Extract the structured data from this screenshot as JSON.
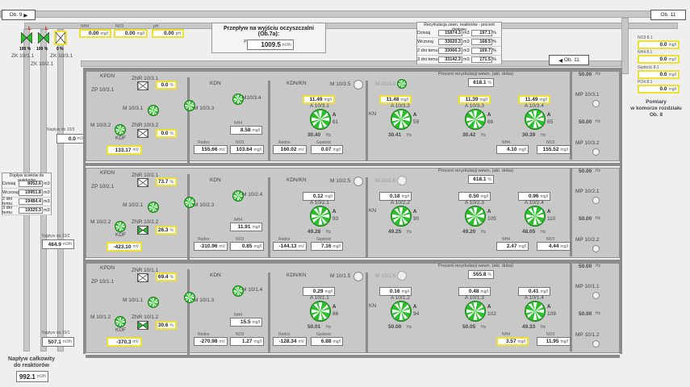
{
  "header": {
    "ob9": "Ob. 9",
    "ob11_top": "Ob. 11",
    "ob11_mid": "Ob. 11"
  },
  "flow_title": "Przepływ na wyjściu oczyszczalni (Ob.7a):",
  "flow_small": "Przepływ 7a.1",
  "flow_value": "1009.5",
  "flow_unit": "m3/h",
  "top_params": [
    {
      "label": "NH4",
      "value": "0.00",
      "unit": "mg/l"
    },
    {
      "label": "NO3",
      "value": "0.00",
      "unit": "mg/l"
    },
    {
      "label": "pH",
      "value": "0.00",
      "unit": "pH"
    }
  ],
  "recirc_ext": {
    "title": "Recyrkulacja zewn. reaktorów - procent dopływu",
    "rows": [
      {
        "d": "Dzisiaj",
        "v": "15874.3",
        "u": "m3",
        "p": "197.1",
        "pu": "%"
      },
      {
        "d": "Wczoraj",
        "v": "33620.3",
        "u": "m3",
        "p": "168.5",
        "pu": "%"
      },
      {
        "d": "2 dni temu",
        "v": "33066.3",
        "u": "m3",
        "p": "169.7",
        "pu": "%"
      },
      {
        "d": "3 dni temu",
        "v": "33142.3",
        "u": "m3",
        "p": "171.5",
        "pu": "%"
      }
    ]
  },
  "left_valves": {
    "zk1": "ZK 10/1.1",
    "zk2": "ZK 10/2.1",
    "zk3": "ZK 10/3.1",
    "p1": "100",
    "p2": "100",
    "p3": "0",
    "pu": "%"
  },
  "doplyw_r": {
    "title": "Dopływ ścieków do reaktorów",
    "rows": [
      {
        "d": "Dzisiaj",
        "v": "8052.6",
        "u": "m3"
      },
      {
        "d": "Wczoraj",
        "v": "19951.8",
        "u": "m3"
      },
      {
        "d": "2 dni temu",
        "v": "19484.4",
        "u": "m3"
      },
      {
        "d": "3 dni temu",
        "v": "19325.3",
        "u": "m3"
      }
    ]
  },
  "naplywy": [
    {
      "label": "Napływ do 10/3",
      "value": "0.0",
      "unit": "m3/h"
    },
    {
      "label": "Napływ do 10/2",
      "value": "484.9",
      "unit": "m3/h"
    },
    {
      "label": "Napływ do 10/1",
      "value": "507.1",
      "unit": "m3/h"
    }
  ],
  "total": {
    "label1": "Napływ całkowity",
    "label2": "do reaktorów",
    "value": "992.1",
    "unit": "m3/h"
  },
  "pomiary": {
    "rows": [
      {
        "label": "NO3 8.1",
        "value": "0.0",
        "unit": "mg/l"
      },
      {
        "label": "NH4 8.1",
        "value": "0.0",
        "unit": "mg/l"
      },
      {
        "label": "Gęstość 8.1",
        "value": "0.0",
        "unit": "mg/l"
      },
      {
        "label": "PO4 8.1",
        "value": "0.0",
        "unit": "mg/l"
      }
    ],
    "title1": "Pomiary",
    "title2": "w komorze rozdziału",
    "title3": "Ob. 8"
  },
  "reactors": [
    {
      "kpdn": "KPDN",
      "zp": "ZP 10/3.1",
      "znr1": "ZNR 10/3.1",
      "znr1v": "0.0",
      "znr2": "ZNR 10/3.2",
      "znr2v": "0.0",
      "m1": "M 10/3.1",
      "m2": "M 10/3.2",
      "m3": "M10/3.4",
      "m35": "M 10/3.5",
      "m36": "M 10/3.6",
      "kdf": "KDF",
      "redox1": "133.17",
      "redox1u": "mV",
      "kdn": "KDN",
      "kdnkn": "KDN/KN",
      "kn": "KN",
      "nh4": "8.58",
      "redox2": "155.66",
      "no3": "103.64",
      "redox3": "160.02",
      "gest": "0.07",
      "o1": "11.49",
      "o2": "11.48",
      "o3": "11.39",
      "o4": "11.49",
      "recirc": "618.1",
      "recirc_title": "Procent recyrkulacji wewn. (akt. doba)",
      "mp1": "MP 10/3.1",
      "mp2": "MP 10/3.2",
      "mp1v": "50.00",
      "mp2v": "50.00",
      "nh4b": "4.10",
      "no3b": "155.52",
      "aer": [
        {
          "n": "A 10/3.1",
          "hz": "30.40",
          "a": "61"
        },
        {
          "n": "A 10/3.2",
          "hz": "30.41",
          "a": "59"
        },
        {
          "n": "A 10/3.3",
          "hz": "30.42",
          "a": "66"
        },
        {
          "n": "A 10/3.4",
          "hz": "30.39",
          "a": "65"
        }
      ]
    },
    {
      "kpdn": "KPDN",
      "zp": "ZP 10/2.1",
      "znr1": "ZNR 10/2.1",
      "znr1v": "73.7",
      "znr2": "ZNR 10/2.2",
      "znr2v": "26.3",
      "m1": "M 10/2.1",
      "m2": "M 10/2.2",
      "m3": "M 10/2.4",
      "m35": "M 10/2.5",
      "m36": "M 10/2.6",
      "kdf": "KDF",
      "redox1": "-423.10",
      "redox1u": "mV",
      "kdn": "KDN",
      "kdnkn": "KDN/KN",
      "kn": "KN",
      "nh4": "11.91",
      "redox2": "-310.96",
      "no3": "0.85",
      "redox3": "-144.13",
      "gest": "7.16",
      "o1": "0.12",
      "o2": "0.18",
      "o3": "0.50",
      "o4": "0.96",
      "recirc": "618.1",
      "recirc_title": "Procent recyrkulacji wewn. (akt. doba)",
      "mp1": "MP 10/2.1",
      "mp2": "MP 10/2.2",
      "mp1v": "50.00",
      "mp2v": "50.00",
      "nh4b": "2.47",
      "no3b": "4.44",
      "p2": "97",
      "vp": "70",
      "aer": [
        {
          "n": "A 10/2.1",
          "hz": "49.28",
          "a": "93"
        },
        {
          "n": "A 10/2.2",
          "hz": "49.25",
          "a": "90"
        },
        {
          "n": "A 10/2.3",
          "hz": "49.20",
          "a": "105"
        },
        {
          "n": "A 10/2.4",
          "hz": "48.05",
          "a": "110"
        }
      ]
    },
    {
      "kpdn": "KPDN",
      "zp": "ZP 10/1.1",
      "znr1": "ZNR 10/1.1",
      "znr1v": "69.4",
      "znr2": "ZNR 10/1.2",
      "znr2v": "30.6",
      "m1": "M 10/1.1",
      "m2": "M 10/1.2",
      "m3": "M 10/1.4",
      "m35": "M 10/1.5",
      "m36": "M 10/1.6",
      "kdf": "KDF",
      "redox1": "-370.3",
      "redox1u": "mV",
      "kdn": "KDN",
      "kdnkn": "KDN/KN",
      "kn": "KN",
      "nh4": "15.5",
      "redox2": "-270.98",
      "no3": "1.27",
      "redox3": "-128.34",
      "gest": "6.88",
      "o1": "0.29",
      "o2": "0.16",
      "o3": "0.48",
      "o4": "0.41",
      "recirc": "555.8",
      "recirc_title": "Procent recyrkulacji wewn. (akt. doba)",
      "mp1": "MP 10/1.1",
      "mp2": "MP 10/1.2",
      "mp1v": "50.00",
      "mp2v": "50.00",
      "nh4b": "3.57",
      "no3b": "11.95",
      "p1": "100",
      "p2": "100",
      "vp": "60",
      "aer": [
        {
          "n": "A 10/1.1",
          "hz": "50.01",
          "a": "86"
        },
        {
          "n": "A 10/1.2",
          "hz": "50.00",
          "a": "94"
        },
        {
          "n": "A 10/1.3",
          "hz": "50.05",
          "a": "102"
        },
        {
          "n": "A 10/1.4",
          "hz": "49.33",
          "a": "109"
        }
      ]
    }
  ],
  "units": {
    "mgl": "mg/l",
    "mv": "mV",
    "hz": "Hz",
    "a": "A",
    "pct": "%",
    "m3": "m3"
  },
  "labels": {
    "nh4": "NH4",
    "no3": "NO3",
    "redox": "Redox",
    "gest": "Gęstość",
    "m": "M 10/3.3",
    "mb": "M 10/2.3",
    "mc": "M 10/1.3"
  },
  "colors": {
    "green": "#2bbf2b",
    "yellow": "#f0e030",
    "pipe": "#c7c7c7"
  }
}
